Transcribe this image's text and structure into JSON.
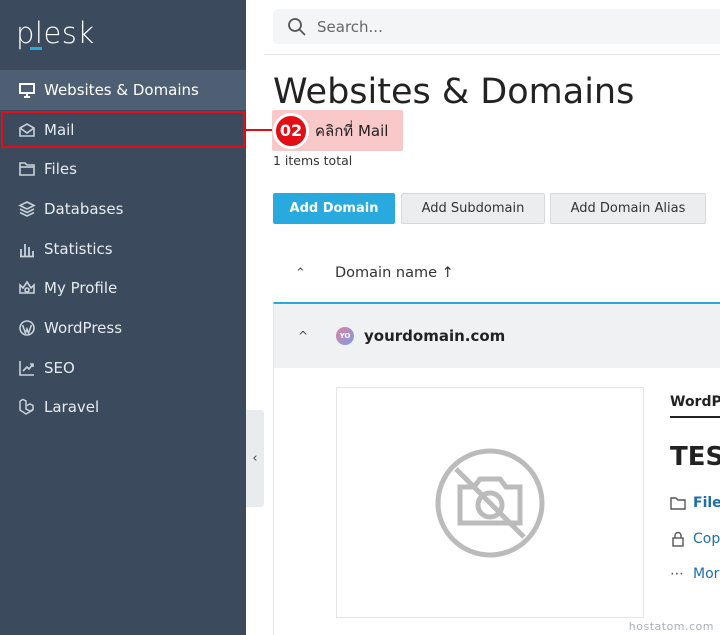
{
  "sidebar": {
    "logo": "plesk",
    "items": [
      {
        "label": "Websites & Domains",
        "icon": "monitor-icon"
      },
      {
        "label": "Mail",
        "icon": "mail-icon"
      },
      {
        "label": "Files",
        "icon": "folder-icon"
      },
      {
        "label": "Databases",
        "icon": "database-icon"
      },
      {
        "label": "Statistics",
        "icon": "chart-icon"
      },
      {
        "label": "My Profile",
        "icon": "profile-icon"
      },
      {
        "label": "WordPress",
        "icon": "wordpress-icon"
      },
      {
        "label": "SEO",
        "icon": "seo-icon"
      },
      {
        "label": "Laravel",
        "icon": "laravel-icon"
      }
    ],
    "collapse_glyph": "‹"
  },
  "search": {
    "placeholder": "Search..."
  },
  "main": {
    "title": "Websites & Domains",
    "items_total": "1 items total",
    "buttons": {
      "add_domain": "Add Domain",
      "add_subdomain": "Add Subdomain",
      "add_alias": "Add Domain Alias"
    },
    "column": {
      "sort_glyph": "⌃",
      "name": "Domain name ↑"
    },
    "domain": {
      "name": "yourdomain.com",
      "icon_text": "YO",
      "chevron": "^"
    },
    "card": {
      "tab": "WordPr",
      "site_title": "TEST",
      "link_files": "Files",
      "link_copy": "Copy",
      "link_more": "Mor",
      "more_glyph": "⋯"
    }
  },
  "callout": {
    "number": "02",
    "text": "คลิกที่ Mail"
  },
  "watermark": "hostatom.com",
  "colors": {
    "sidebar": "#3b4a5c",
    "accent": "#28aade",
    "highlight": "#e30d16",
    "callout_bg": "#f9c8c8"
  }
}
